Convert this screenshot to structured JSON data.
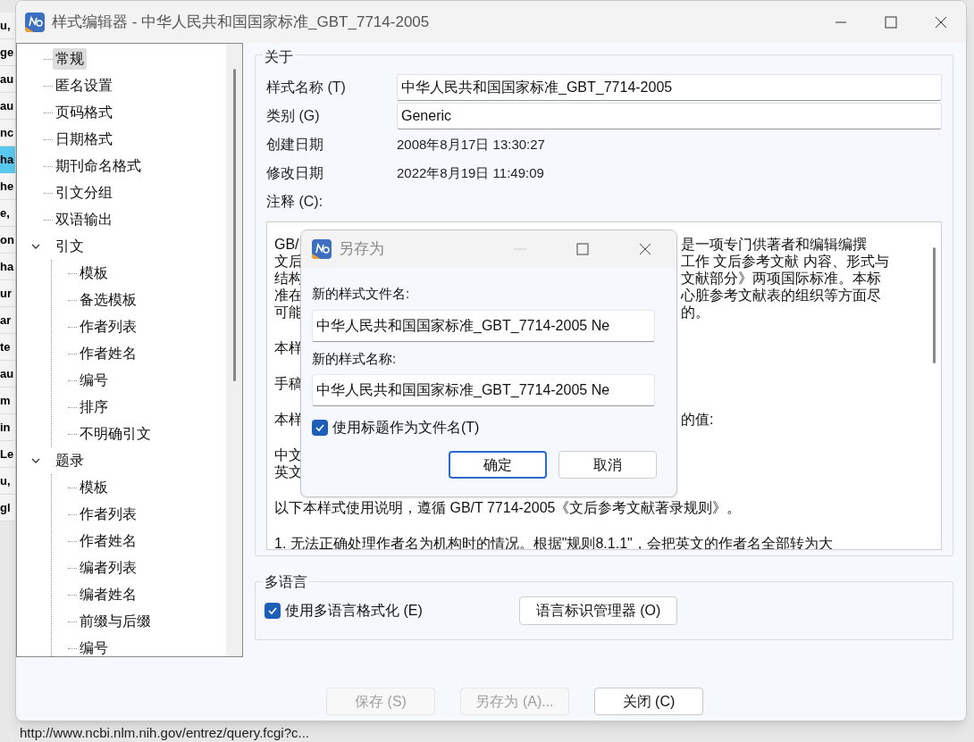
{
  "backdrop": {
    "rows": [
      {
        "text": "u,",
        "selected": false
      },
      {
        "text": "ge",
        "selected": false
      },
      {
        "text": "au",
        "selected": false
      },
      {
        "text": "au",
        "selected": false
      },
      {
        "text": "nc",
        "selected": false
      },
      {
        "text": "ha",
        "selected": true
      },
      {
        "text": "he",
        "selected": false
      },
      {
        "text": "e,",
        "selected": false
      },
      {
        "text": "on",
        "selected": false
      },
      {
        "text": "ha",
        "selected": false
      },
      {
        "text": "ur",
        "selected": false
      },
      {
        "text": "ar",
        "selected": false
      },
      {
        "text": "te",
        "selected": false
      },
      {
        "text": "au",
        "selected": false
      },
      {
        "text": "m",
        "selected": false
      },
      {
        "text": "in",
        "selected": false
      },
      {
        "text": "Le",
        "selected": false
      },
      {
        "text": "u,",
        "selected": false
      },
      {
        "text": "gl",
        "selected": false
      }
    ],
    "url": "http://www.ncbi.nlm.nih.gov/entrez/query.fcgi?c..."
  },
  "window": {
    "title": "样式编辑器 - 中华人民共和国国家标准_GBT_7714-2005"
  },
  "tree": [
    {
      "label": "常规",
      "selected": true
    },
    {
      "label": "匿名设置",
      "selected": false
    },
    {
      "label": "页码格式",
      "selected": false
    },
    {
      "label": "日期格式",
      "selected": false
    },
    {
      "label": "期刊命名格式",
      "selected": false
    },
    {
      "label": "引文分组",
      "selected": false
    },
    {
      "label": "双语输出",
      "selected": false
    },
    {
      "label": "引文",
      "selected": false,
      "expanded": true,
      "children": [
        {
          "label": "模板",
          "selected": false
        },
        {
          "label": "备选模板",
          "selected": false
        },
        {
          "label": "作者列表",
          "selected": false
        },
        {
          "label": "作者姓名",
          "selected": false
        },
        {
          "label": "编号",
          "selected": false
        },
        {
          "label": "排序",
          "selected": false
        },
        {
          "label": "不明确引文",
          "selected": false
        }
      ]
    },
    {
      "label": "题录",
      "selected": false,
      "expanded": true,
      "children": [
        {
          "label": "模板",
          "selected": false
        },
        {
          "label": "作者列表",
          "selected": false
        },
        {
          "label": "作者姓名",
          "selected": false
        },
        {
          "label": "编者列表",
          "selected": false
        },
        {
          "label": "编者姓名",
          "selected": false
        },
        {
          "label": "前缀与后缀",
          "selected": false
        },
        {
          "label": "编号",
          "selected": false
        }
      ]
    }
  ],
  "about": {
    "legend": "关于",
    "fields": [
      {
        "kind": "input",
        "label": "样式名称 (T)",
        "value": "中华人民共和国国家标准_GBT_7714-2005"
      },
      {
        "kind": "input",
        "label": "类别 (G)",
        "value": "Generic"
      },
      {
        "kind": "text",
        "label": "创建日期",
        "value": "2008年8月17日 13:30:27"
      },
      {
        "kind": "text",
        "label": "修改日期",
        "value": "2022年8月19日 11:49:09"
      }
    ],
    "notes_label": "注释 (C):",
    "notes": [
      [
        {
          "left": "GB/",
          "right": "是一项专门供著者和编辑编撰"
        },
        {
          "left": "文后",
          "right": "工作 文后参考文献 内容、形式与"
        },
        {
          "left": "结构",
          "right": "文献部分》两项国际标准。本标"
        },
        {
          "left": "准在",
          "right": "心脏参考文献表的组织等方面尽"
        },
        {
          "left": "可能",
          "right": "的。"
        }
      ],
      [
        {
          "left": "本样"
        }
      ],
      [
        {
          "left": "手稿"
        }
      ],
      [
        {
          "left": "本样",
          "right": "的值:"
        }
      ],
      [
        {
          "left": "中文"
        },
        {
          "left": "英文"
        }
      ],
      [
        {
          "left": "以下本样式使用说明，遵循 GB/T 7714-2005《文后参考文献著录规则》。"
        }
      ],
      [
        {
          "left": "1. 无法正确处理作者名为机构时的情况。根据\"规则8.1.1\"，会把英文的作者名全部转为大"
        }
      ]
    ]
  },
  "multilang": {
    "legend": "多语言",
    "checkbox": {
      "label": "使用多语言格式化 (E)",
      "checked": true
    },
    "button": "语言标识管理器 (O)"
  },
  "buttons": [
    {
      "label": "保存 (S)",
      "disabled": true
    },
    {
      "label": "另存为 (A)...",
      "disabled": true
    },
    {
      "label": "关闭 (C)",
      "disabled": false
    }
  ],
  "dialog": {
    "title": "另存为",
    "fields": [
      {
        "label": "新的样式文件名:",
        "value": "中华人民共和国国家标准_GBT_7714-2005 Ne"
      },
      {
        "label": "新的样式名称:",
        "value": "中华人民共和国国家标准_GBT_7714-2005 Ne"
      }
    ],
    "checkbox": {
      "label": "使用标题作为文件名(T)",
      "checked": true
    },
    "buttons": [
      {
        "label": "确定",
        "default": true
      },
      {
        "label": "取消",
        "default": false
      }
    ]
  }
}
